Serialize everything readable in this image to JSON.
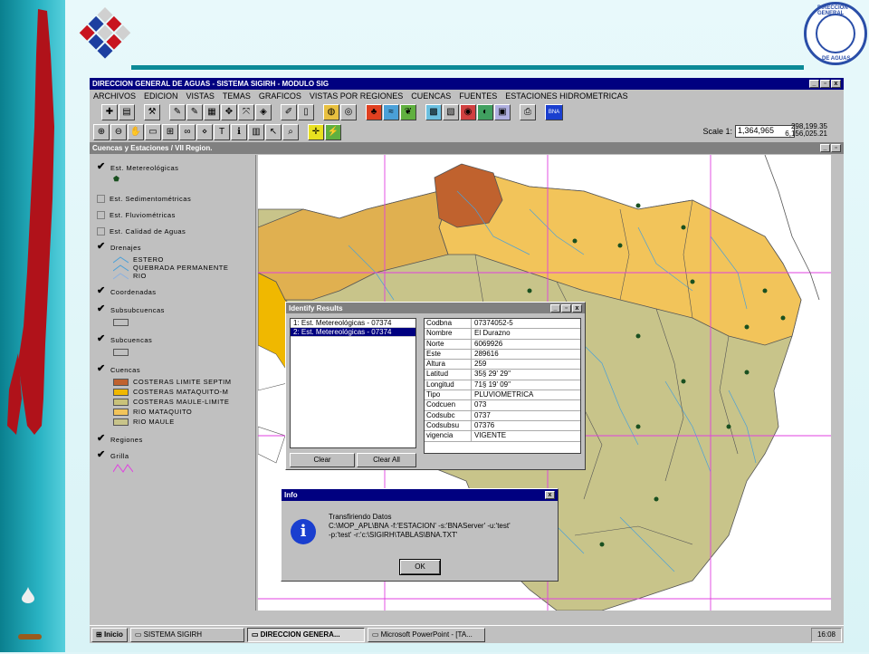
{
  "app": {
    "window_title": "DIRECCION GENERAL DE AGUAS - SISTEMA SIGIRH - MODULO SIG",
    "view_title": "Cuencas y Estaciones / VII Region.",
    "window_controls": [
      "_",
      "▫",
      "x"
    ]
  },
  "seal": {
    "top_text": "DIRECCION GENERAL",
    "bottom_text": "DE AGUAS"
  },
  "menu": [
    "ARCHIVOS",
    "EDICION",
    "VISTAS",
    "TEMAS",
    "GRAFICOS",
    "VISTAS POR REGIONES",
    "CUENCAS",
    "FUENTES",
    "ESTACIONES HIDROMETRICAS"
  ],
  "toolbar": {
    "scale_label": "Scale 1:",
    "scale_value": "1,364,965",
    "coord_x": "298,199.35",
    "coord_y": "6,156,025.21",
    "bna_label": "BNA"
  },
  "legend": {
    "items": [
      {
        "label": "Est. Metereológicas",
        "checked": true
      },
      {
        "label": "Est. Sedimentométricas",
        "checked": false
      },
      {
        "label": "Est. Fluviométricas",
        "checked": false
      },
      {
        "label": "Est. Calidad de Aguas",
        "checked": false
      },
      {
        "label": "Drenajes",
        "checked": true
      },
      {
        "label": "Coordenadas",
        "checked": true
      },
      {
        "label": "Subsubcuencas",
        "checked": true
      },
      {
        "label": "Subcuencas",
        "checked": true
      },
      {
        "label": "Cuencas",
        "checked": true
      },
      {
        "label": "Regiones",
        "checked": true
      },
      {
        "label": "Grilla",
        "checked": true
      }
    ],
    "drenajes": [
      "ESTERO",
      "QUEBRADA PERMANENTE",
      "RIO"
    ],
    "cuencas": [
      {
        "label": "COSTERAS LIMITE SEPTIM",
        "color": "#c0622e"
      },
      {
        "label": "COSTERAS MATAQUITO-M",
        "color": "#f0b800"
      },
      {
        "label": "COSTERAS MAULE-LIMITE",
        "color": "#c9c27a"
      },
      {
        "label": "RIO MATAQUITO",
        "color": "#f2c45a"
      },
      {
        "label": "RIO MAULE",
        "color": "#c8c48a"
      }
    ]
  },
  "identify": {
    "title": "Identify Results",
    "list": [
      "1:  Est. Metereológicas - 07374",
      "2:  Est. Metereológicas - 07374"
    ],
    "fields": [
      {
        "k": "Codbna",
        "v": "07374052-5"
      },
      {
        "k": "Nombre",
        "v": "El Durazno"
      },
      {
        "k": "Norte",
        "v": "6069926"
      },
      {
        "k": "Este",
        "v": "289616"
      },
      {
        "k": "Altura",
        "v": "259"
      },
      {
        "k": "Latitud",
        "v": "35§ 29' 29''"
      },
      {
        "k": "Longitud",
        "v": "71§ 19' 09''"
      },
      {
        "k": "Tipo",
        "v": "PLUVIOMETRICA"
      },
      {
        "k": "Codcuen",
        "v": "073"
      },
      {
        "k": "Codsubc",
        "v": "0737"
      },
      {
        "k": "Codsubsu",
        "v": "07376"
      },
      {
        "k": "vigencia",
        "v": "VIGENTE"
      }
    ],
    "clear": "Clear",
    "clear_all": "Clear All"
  },
  "info": {
    "title": "Info",
    "line1": "Transfiriendo Datos",
    "line2": "C:\\MOP_APL\\BNA -f:'ESTACION' -s:'BNAServer' -u:'test'",
    "line3": "-p:'test' -r:'c:\\SIGIRH\\TABLAS\\BNA.TXT'",
    "ok": "OK",
    "close": "x"
  },
  "taskbar": {
    "start": "Inicio",
    "tasks": [
      "SISTEMA SIGIRH",
      "DIRECCION GENERA...",
      "Microsoft PowerPoint - [TA..."
    ],
    "clock": "16:08"
  }
}
